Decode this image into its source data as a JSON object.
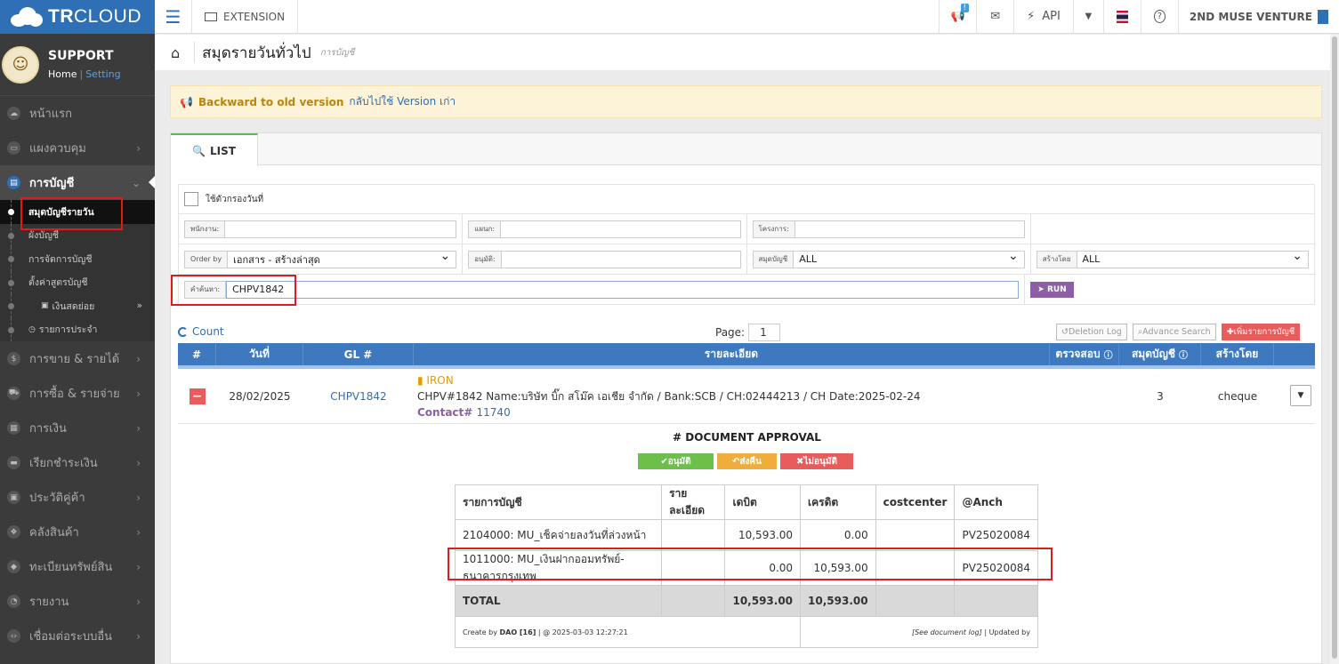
{
  "app": {
    "brand_bold": "TR",
    "brand_rest": "CLOUD"
  },
  "topbar": {
    "extension_label": "EXTENSION",
    "badge": "!",
    "api_label": "API",
    "company": "2ND MUSE VENTURE"
  },
  "profile": {
    "name": "SUPPORT",
    "home": "Home",
    "separator": "|",
    "setting": "Setting"
  },
  "sidebar": {
    "items": [
      {
        "label": "หน้าแรก",
        "icon": "cloud-icon"
      },
      {
        "label": "แผงควบคุม",
        "icon": "monitor-icon"
      },
      {
        "label": "การบัญชี",
        "icon": "book-icon"
      }
    ],
    "sub_items": [
      {
        "label": "สมุดบัญชีรายวัน"
      },
      {
        "label": "ผังบัญชี"
      },
      {
        "label": "การจัดการบัญชี"
      },
      {
        "label": "ตั้งค่าสูตรบัญชี"
      },
      {
        "label": "เงินสดย่อย"
      },
      {
        "label": "รายการประจำ"
      }
    ],
    "items_after": [
      {
        "label": "การขาย & รายได้",
        "icon": "dollar-icon"
      },
      {
        "label": "การซื้อ & รายจ่าย",
        "icon": "cart-icon"
      },
      {
        "label": "การเงิน",
        "icon": "calendar-icon"
      },
      {
        "label": "เรียกชำระเงิน",
        "icon": "card-icon"
      },
      {
        "label": "ประวัติคู่ค้า",
        "icon": "contact-icon"
      },
      {
        "label": "คลังสินค้า",
        "icon": "cubes-icon"
      },
      {
        "label": "ทะเบียนทรัพย์สิน",
        "icon": "diamond-icon"
      },
      {
        "label": "รายงาน",
        "icon": "report-icon"
      },
      {
        "label": "เชื่อมต่อระบบอื่น",
        "icon": "code-icon"
      }
    ]
  },
  "header": {
    "title": "สมุดรายวันทั่วไป",
    "subtitle": "การบัญชี"
  },
  "notice": {
    "strong": "Backward to old version",
    "link": "กลับไปใช้ Version เก่า"
  },
  "tab": {
    "label": "LIST"
  },
  "filters": {
    "date_filter_label": "ใช้ตัวกรองวันที่",
    "employee_label": "พนักงาน:",
    "department_label": "แผนก:",
    "project_label": "โครงการ:",
    "order_label": "Order by",
    "order_value": "เอกสาร - สร้างล่าสุด",
    "approve_label": "อนุมัติ:",
    "book_label": "สมุดบัญชี",
    "book_value": "ALL",
    "created_label": "สร้างโดย",
    "created_value": "ALL",
    "search_label": "คำค้นหา:",
    "search_value": "CHPV1842",
    "run": "RUN"
  },
  "list": {
    "count": "Count",
    "page_label": "Page:",
    "page_value": "1",
    "deletion_log": "Deletion Log",
    "advance_search": "Advance Search",
    "add_entry": "เพิ่มรายการบัญชี"
  },
  "grid": {
    "headers": [
      "#",
      "วันที่",
      "GL #",
      "รายละเอียด",
      "ตรวจสอบ",
      "สมุดบัญชี",
      "สร้างโดย"
    ],
    "row": {
      "date": "28/02/2025",
      "gl": "CHPV1842",
      "tag": "IRON",
      "detail": "CHPV#1842 Name:บริษัท บิ๊ก สโม๊ค เอเชีย จำกัด / Bank:SCB / CH:02444213 / CH Date:2025-02-24",
      "contact_label": "Contact#",
      "contact_num": "11740",
      "book": "3",
      "created_by": "cheque"
    }
  },
  "approval": {
    "title": "# DOCUMENT APPROVAL",
    "approve": "อนุมัติ",
    "return": "ส่งคืน",
    "reject": "ไม่อนุมัติ"
  },
  "journal": {
    "headers": [
      "รายการบัญชี",
      "รายละเอียด",
      "เดบิต",
      "เครดิต",
      "costcenter",
      "@Anch"
    ],
    "rows": [
      {
        "account": "2104000: MU_เช็คจ่ายลงวันที่ล่วงหน้า",
        "detail": "",
        "debit": "10,593.00",
        "credit": "0.00",
        "cc": "",
        "anch": "PV25020084"
      },
      {
        "account": "1011000: MU_เงินฝากออมทรัพย์-ธนาคารกรุงเทพ",
        "detail": "",
        "debit": "0.00",
        "credit": "10,593.00",
        "cc": "",
        "anch": "PV25020084"
      }
    ],
    "total_label": "TOTAL",
    "total_debit": "10,593.00",
    "total_credit": "10,593.00",
    "footer_left_pre": "Create by",
    "footer_user": "DAO [16]",
    "footer_left_post": "| @ 2025-03-03 12:27:21",
    "footer_right_link": "[See document log]",
    "footer_right_post": "| Updated by"
  },
  "colors": {
    "brand": "#2f6fb5",
    "sidebar": "#3b3b3b",
    "grid_header": "#3e79c0",
    "danger": "#e85c5c",
    "success": "#6cbf4a",
    "warning": "#f0ad3b",
    "highlight": "#e01b1b"
  }
}
